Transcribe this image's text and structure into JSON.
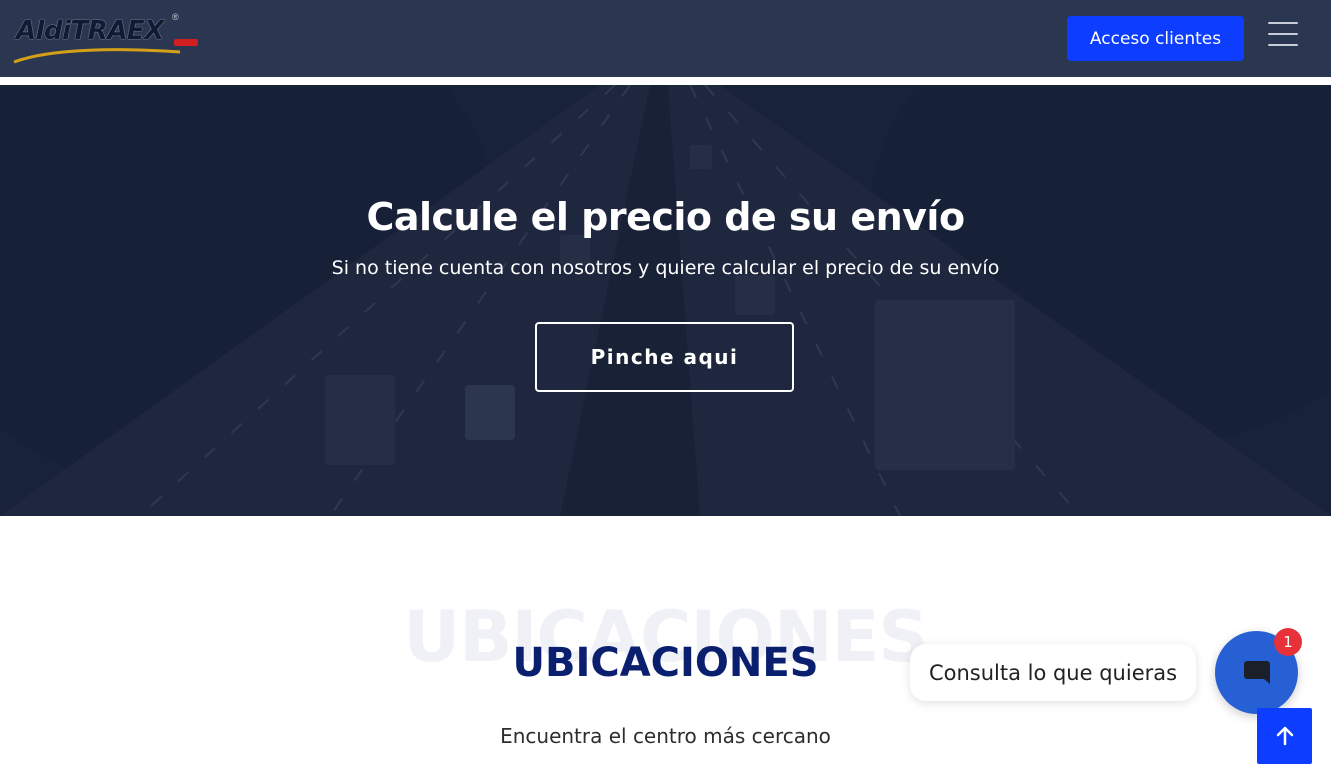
{
  "header": {
    "logo_text": "AldiTRAEX",
    "logo_registered": "®",
    "access_button_label": "Acceso clientes"
  },
  "hero": {
    "title": "Calcule el precio de su envío",
    "subtitle": "Si no tiene cuenta con nosotros y quiere calcular el precio de su envío",
    "button_label": "Pinche aqui"
  },
  "locations": {
    "ghost_title": "UBICACIONES",
    "title": "UBICACIONES",
    "subtitle": "Encuentra el centro más cercano"
  },
  "chat": {
    "prompt": "Consulta lo que quieras",
    "badge_count": "1",
    "icon": "chat-icon"
  },
  "scroll_top": {
    "icon": "arrow-up-icon"
  },
  "menu": {
    "icon": "hamburger-icon"
  },
  "colors": {
    "header_bg": "#2b3650",
    "accent_blue": "#0d3dff",
    "title_navy": "#0a1f6e",
    "chat_blue": "#2660d4",
    "badge_red": "#e8323a"
  }
}
